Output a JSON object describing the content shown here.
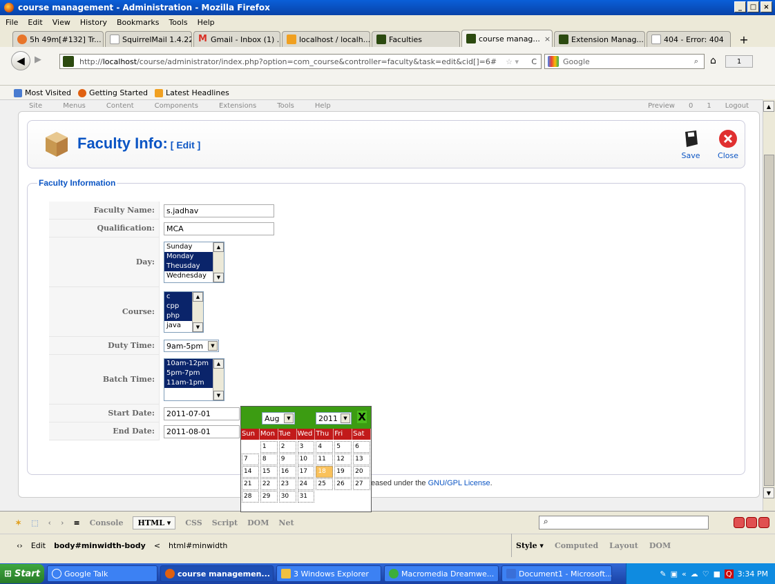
{
  "window": {
    "title": "course management - Administration - Mozilla Firefox"
  },
  "menu": [
    "File",
    "Edit",
    "View",
    "History",
    "Bookmarks",
    "Tools",
    "Help"
  ],
  "tabs": [
    {
      "label": "5h 49m[#132] Tr...",
      "color": "#e8752a"
    },
    {
      "label": "SquirrelMail 1.4.22",
      "color": "#dcdcdc"
    },
    {
      "label": "Gmail - Inbox (1) ...",
      "color": "#d93025"
    },
    {
      "label": "localhost / localh...",
      "color": "#f0a020"
    },
    {
      "label": "Faculties",
      "color": "#2c4a10"
    },
    {
      "label": "course manag...",
      "color": "#2c4a10",
      "active": true,
      "close": "×"
    },
    {
      "label": "Extension Manag...",
      "color": "#2c4a10"
    },
    {
      "label": "404 - Error: 404",
      "color": "#dcdcdc"
    }
  ],
  "newtab": "+",
  "url": {
    "prefix": "http://",
    "host": "localhost",
    "path": "/course/administrator/index.php?option=com_course&controller=faculty&task=edit&cid[]=6#"
  },
  "search": {
    "engine": "Google"
  },
  "addon_label": "1",
  "bookmarks": [
    "Most Visited",
    "Getting Started",
    "Latest Headlines"
  ],
  "joomla_menu": [
    "Site",
    "Menus",
    "Content",
    "Components",
    "Extensions",
    "Tools",
    "Help"
  ],
  "joomla_right": [
    "Preview",
    "0",
    "1",
    "Logout"
  ],
  "header": {
    "title": "Faculty Info:",
    "subtitle": "[ Edit ]"
  },
  "toolbar": {
    "save_label": "Save",
    "close_label": "Close"
  },
  "form": {
    "legend": "Faculty Information",
    "faculty_name_label": "Faculty Name:",
    "faculty_name_value": "s.jadhav",
    "qualification_label": "Qualification:",
    "qualification_value": "MCA",
    "day_label": "Day:",
    "day_options": [
      {
        "text": "Sunday",
        "selected": false
      },
      {
        "text": "Monday",
        "selected": true
      },
      {
        "text": "Theusday",
        "selected": true
      },
      {
        "text": "Wednesday",
        "selected": false
      }
    ],
    "course_label": "Course:",
    "course_options": [
      {
        "text": "c",
        "selected": true
      },
      {
        "text": "cpp",
        "selected": true
      },
      {
        "text": "php",
        "selected": true
      },
      {
        "text": "java",
        "selected": false
      }
    ],
    "duty_label": "Duty Time:",
    "duty_value": "9am-5pm",
    "batch_label": "Batch Time:",
    "batch_options": [
      {
        "text": "10am-12pm",
        "selected": true
      },
      {
        "text": "5pm-7pm",
        "selected": true
      },
      {
        "text": "11am-1pm",
        "selected": true
      }
    ],
    "start_label": "Start Date:",
    "start_value": "2011-07-01",
    "end_label": "End Date:",
    "end_value": "2011-08-01"
  },
  "footer": {
    "text": "eased under the ",
    "link": "GNU/GPL License",
    "dot": "."
  },
  "calendar": {
    "month": "Aug",
    "year": "2011",
    "close": "X",
    "days": [
      "Sun",
      "Mon",
      "Tue",
      "Wed",
      "Thu",
      "Fri",
      "Sat"
    ],
    "dates": [
      "",
      "1",
      "2",
      "3",
      "4",
      "5",
      "6",
      "7",
      "8",
      "9",
      "10",
      "11",
      "12",
      "13",
      "14",
      "15",
      "16",
      "17",
      "18",
      "19",
      "20",
      "21",
      "22",
      "23",
      "24",
      "25",
      "26",
      "27",
      "28",
      "29",
      "30",
      "31"
    ],
    "today": "18"
  },
  "firebug": {
    "tabs": [
      "Console",
      "HTML ▾",
      "CSS",
      "Script",
      "DOM",
      "Net"
    ],
    "edit_label": "Edit",
    "path_current": "body#minwidth-body",
    "path_parent": "html#minwidth",
    "side_tabs": [
      "Style ▾",
      "Computed",
      "Layout",
      "DOM"
    ]
  },
  "taskbar": {
    "start": "Start",
    "items": [
      {
        "label": "Google Talk",
        "color": "#ffffff"
      },
      {
        "label": "course managemen...",
        "color": "#e06010",
        "active": true
      },
      {
        "label": "3 Windows Explorer",
        "color": "#f0c040"
      },
      {
        "label": "Macromedia Dreamwe...",
        "color": "#3cae3c"
      },
      {
        "label": "Document1 - Microsoft...",
        "color": "#3a6fd8"
      }
    ],
    "clock": "3:34 PM"
  }
}
